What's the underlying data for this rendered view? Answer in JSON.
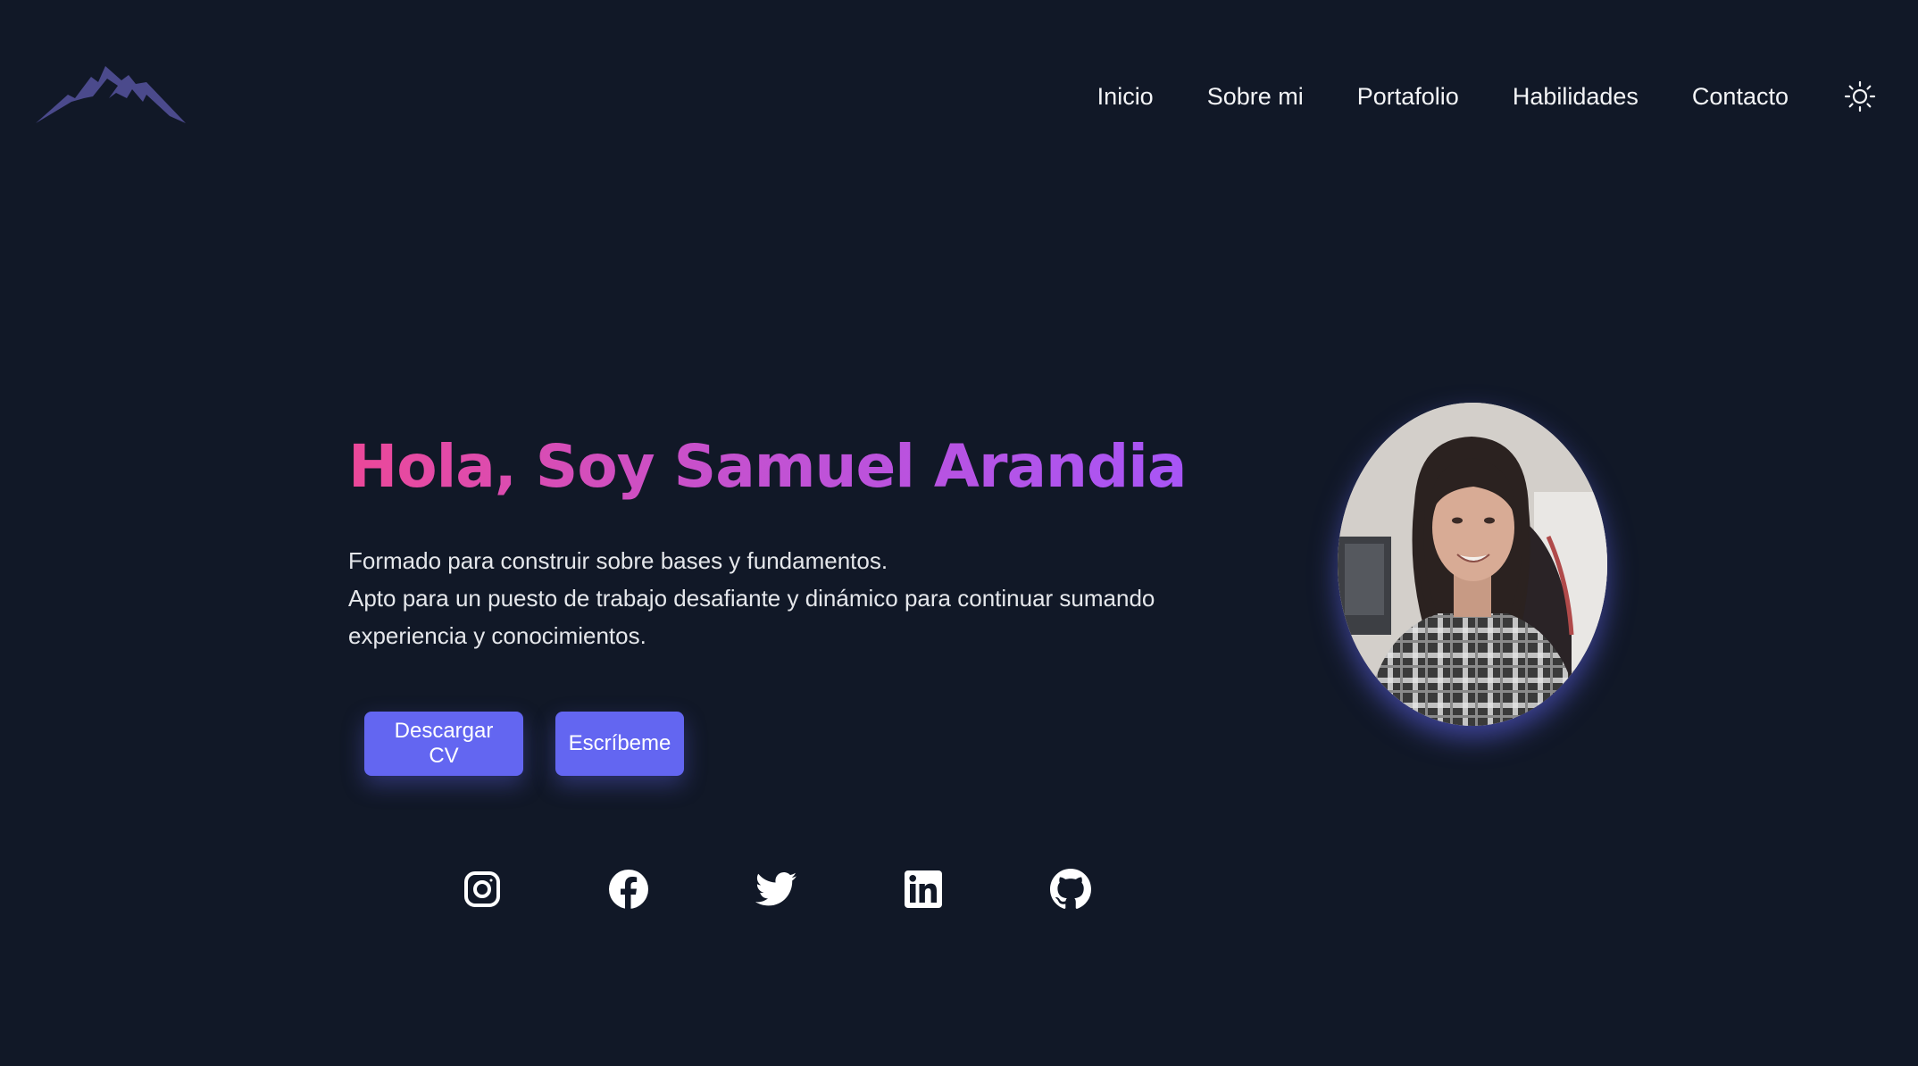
{
  "header": {
    "logo_icon": "mountain-logo-icon",
    "nav": [
      {
        "label": "Inicio"
      },
      {
        "label": "Sobre mi"
      },
      {
        "label": "Portafolio"
      },
      {
        "label": "Habilidades"
      },
      {
        "label": "Contacto"
      }
    ],
    "theme_icon": "sun-icon"
  },
  "hero": {
    "title": "Hola, Soy Samuel Arandia",
    "description_lines": [
      "Formado para construir sobre bases y fundamentos.",
      "Apto para un puesto de trabajo desafiante y dinámico para continuar sumando",
      "experiencia y conocimientos."
    ],
    "buttons": {
      "download_cv": "Descargar CV",
      "write_me": "Escríbeme"
    },
    "socials": [
      {
        "icon": "instagram-icon"
      },
      {
        "icon": "facebook-icon"
      },
      {
        "icon": "twitter-icon"
      },
      {
        "icon": "linkedin-icon"
      },
      {
        "icon": "github-icon"
      }
    ]
  },
  "colors": {
    "background": "#111827",
    "accent": "#6366f1",
    "title_gradient_start": "#ec4899",
    "title_gradient_end": "#a855f7",
    "logo": "#4b4a8c"
  }
}
